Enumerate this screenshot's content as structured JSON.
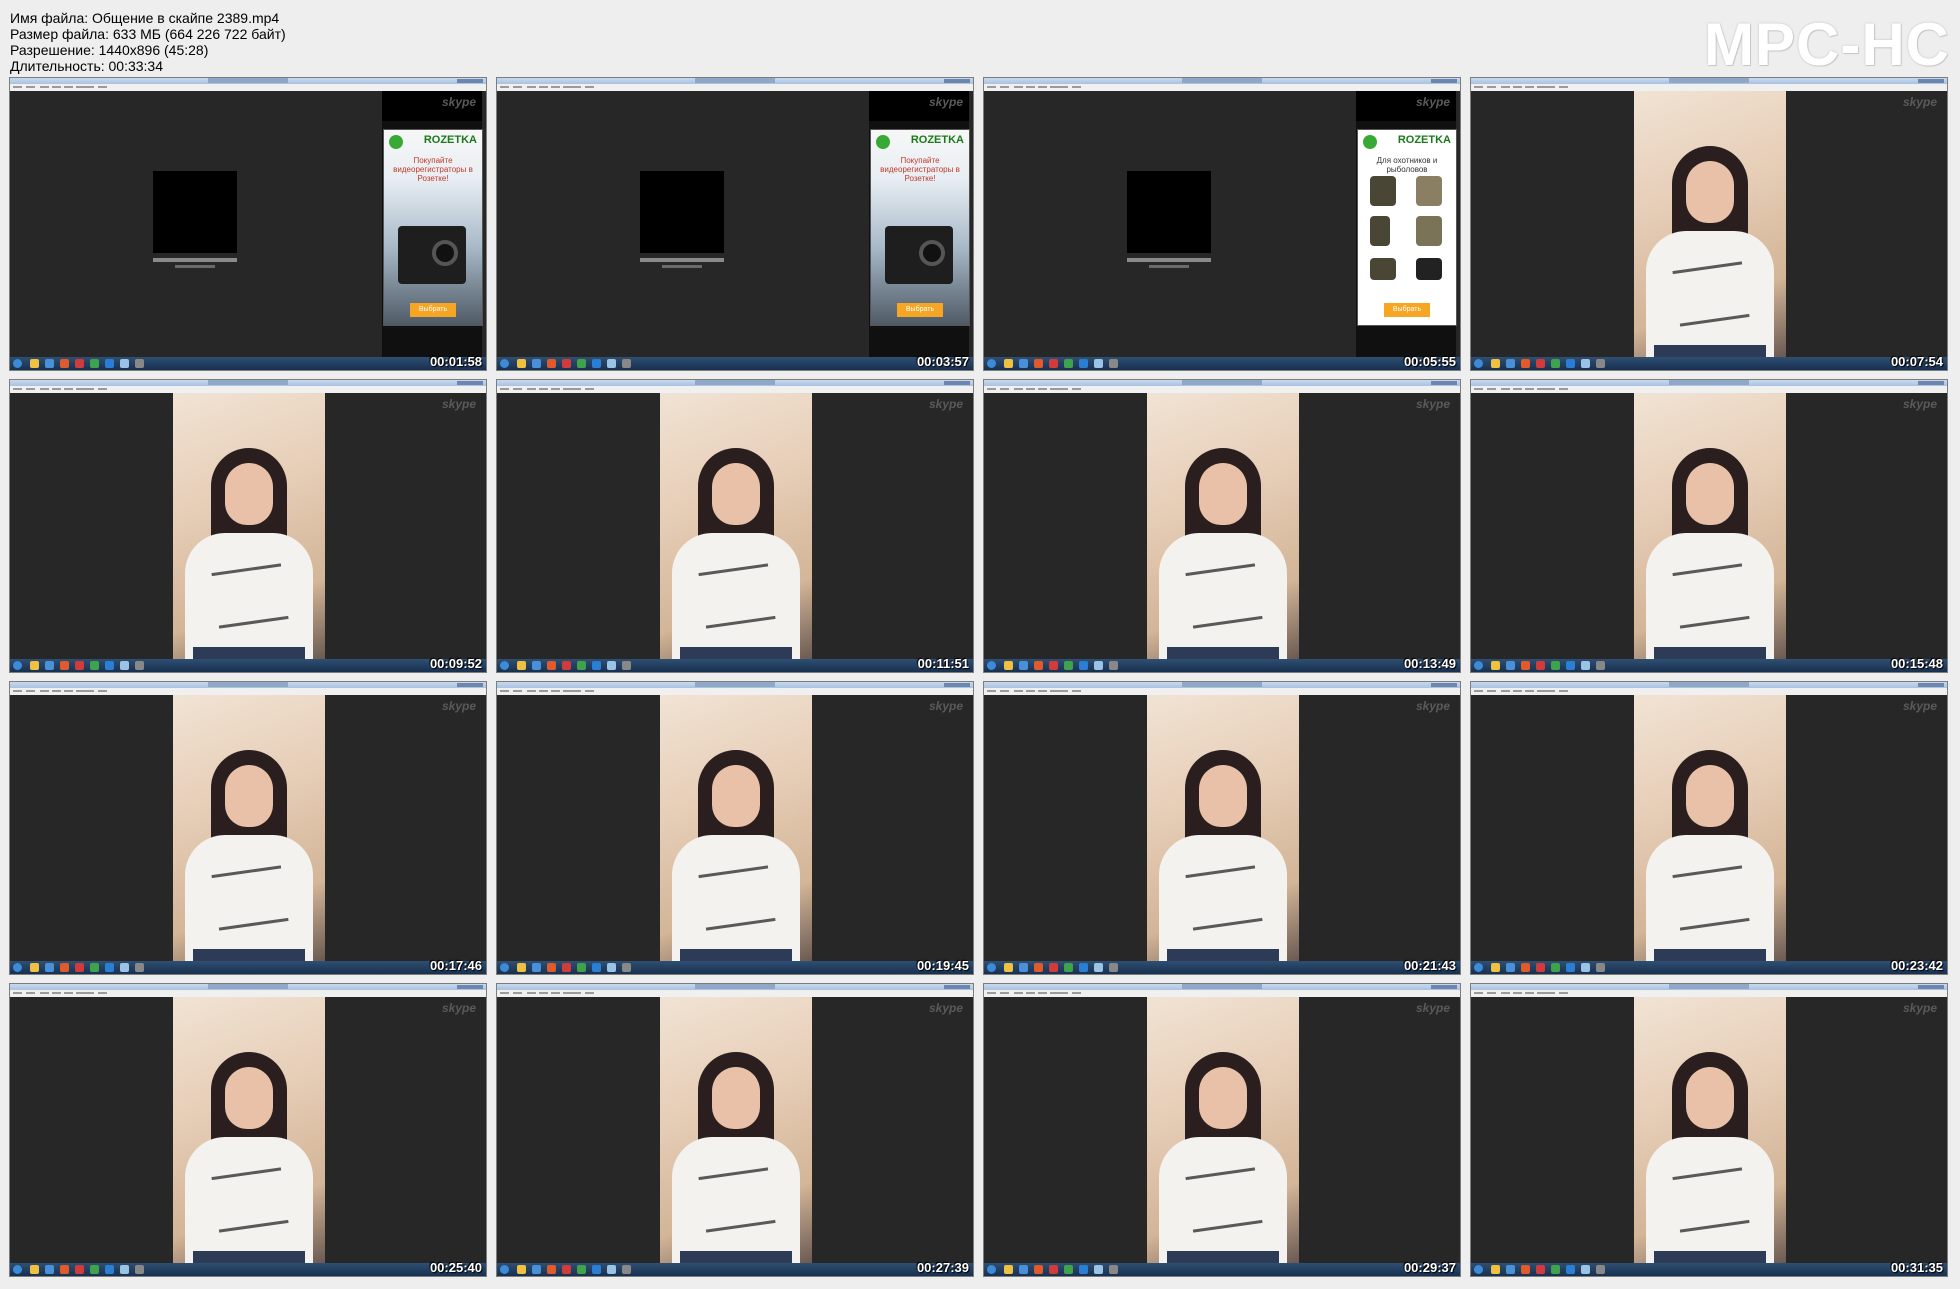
{
  "file_info": {
    "name": "Имя файла: Общение в скайпе 2389.mp4",
    "size": "Размер файла: 633 МБ (664 226 722 байт)",
    "resolution": "Разрешение: 1440x896 (45:28)",
    "duration": "Длительность: 00:33:34"
  },
  "logo": "MPC-HC",
  "skype_watermark": "skype",
  "ad": {
    "brand": "ROZETKA",
    "camera_text": "Покупайте видеорегистраторы в Розетке!",
    "clothes_text": "Для охотников и рыболовов",
    "button": "Выбрать"
  },
  "thumbnails": [
    {
      "time": "00:01:58",
      "content": "avatar-with-ad-camera"
    },
    {
      "time": "00:03:57",
      "content": "avatar-with-ad-camera"
    },
    {
      "time": "00:05:55",
      "content": "avatar-with-ad-clothes"
    },
    {
      "time": "00:07:54",
      "content": "video"
    },
    {
      "time": "00:09:52",
      "content": "video"
    },
    {
      "time": "00:11:51",
      "content": "video"
    },
    {
      "time": "00:13:49",
      "content": "video"
    },
    {
      "time": "00:15:48",
      "content": "video"
    },
    {
      "time": "00:17:46",
      "content": "video"
    },
    {
      "time": "00:19:45",
      "content": "video"
    },
    {
      "time": "00:21:43",
      "content": "video"
    },
    {
      "time": "00:23:42",
      "content": "video"
    },
    {
      "time": "00:25:40",
      "content": "video"
    },
    {
      "time": "00:27:39",
      "content": "video"
    },
    {
      "time": "00:29:37",
      "content": "video"
    },
    {
      "time": "00:31:35",
      "content": "video"
    }
  ],
  "colors": {
    "sheet_background": "#eeeeee",
    "skype_window": "#272727",
    "taskbar": "#1e3a5c",
    "ad_button": "#f6a623",
    "brand_green": "#39a935"
  }
}
